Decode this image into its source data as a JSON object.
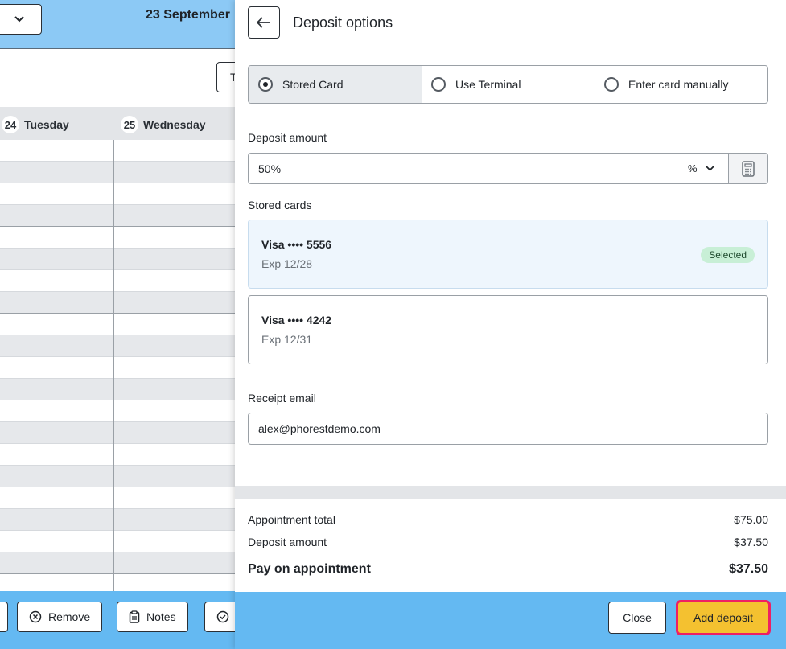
{
  "calendar": {
    "date_label": "23 September",
    "toolbar_button_label": "T",
    "days": [
      {
        "number": "24",
        "name": "Tuesday"
      },
      {
        "number": "25",
        "name": "Wednesday"
      }
    ],
    "bottom_buttons": [
      {
        "label": "Remove",
        "icon": "remove-circle-icon"
      },
      {
        "label": "Notes",
        "icon": "clipboard-icon"
      },
      {
        "label": "",
        "icon": "check-circle-icon"
      }
    ]
  },
  "panel": {
    "title": "Deposit options",
    "payment_methods": [
      {
        "label": "Stored Card",
        "selected": true
      },
      {
        "label": "Use Terminal",
        "selected": false
      },
      {
        "label": "Enter card manually",
        "selected": false
      }
    ],
    "deposit_amount": {
      "label": "Deposit amount",
      "value": "50%",
      "unit": "%"
    },
    "stored_cards": {
      "label": "Stored cards",
      "cards": [
        {
          "name": "Visa •••• 5556",
          "expiry": "Exp 12/28",
          "selected": true,
          "badge": "Selected"
        },
        {
          "name": "Visa •••• 4242",
          "expiry": "Exp 12/31",
          "selected": false
        }
      ]
    },
    "receipt_email": {
      "label": "Receipt email",
      "value": "alex@phorestdemo.com"
    },
    "summary": {
      "appointment_total_label": "Appointment total",
      "appointment_total_value": "$75.00",
      "deposit_amount_label": "Deposit amount",
      "deposit_amount_value": "$37.50",
      "pay_on_appointment_label": "Pay on appointment",
      "pay_on_appointment_value": "$37.50"
    },
    "footer": {
      "close_label": "Close",
      "add_deposit_label": "Add deposit"
    }
  },
  "colors": {
    "header_blue": "#8cc9f5",
    "footer_blue": "#64b9f2",
    "primary_yellow": "#f4c130",
    "highlight_pink": "#ee1f63",
    "selected_badge_green": "#c8efd6"
  }
}
